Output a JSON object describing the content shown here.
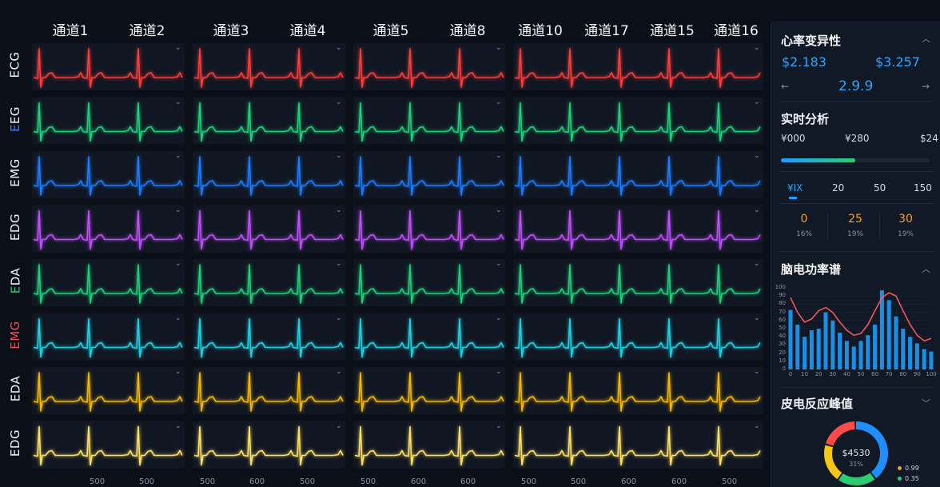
{
  "columns": [
    "通道1",
    "通道2",
    "通道3",
    "通道4",
    "通道5",
    "通道8",
    "通道10",
    "通道17",
    "通道15",
    "通道16"
  ],
  "rows": [
    {
      "label": "ECG",
      "label_color": "#f2f4f8",
      "wave_color": "#ff3b3b"
    },
    {
      "label": "EEG",
      "label_color": "#f2f4f8",
      "label_first_color": "#3d7bff",
      "wave_color": "#1fd17a"
    },
    {
      "label": "EMG",
      "label_color": "#f2f4f8",
      "wave_color": "#1e7bff"
    },
    {
      "label": "EDG",
      "label_color": "#f2f4f8",
      "wave_color": "#c24dff"
    },
    {
      "label": "EDA",
      "label_color": "#f2f4f8",
      "label_first_color": "#1fd17a",
      "wave_color": "#1fd17a"
    },
    {
      "label": "EMG",
      "label_color": "#ff4a4a",
      "wave_color": "#1fd3e6"
    },
    {
      "label": "EDA",
      "label_color": "#f2f4f8",
      "wave_color": "#f5b800"
    },
    {
      "label": "EDG",
      "label_color": "#f2f4f8",
      "wave_color": "#ffe066"
    }
  ],
  "x_axis_ticks": [
    "500",
    "500",
    "500",
    "600",
    "500",
    "500",
    "600",
    "600",
    "500",
    "500",
    "600",
    "600",
    "500"
  ],
  "panel": {
    "hrv": {
      "title": "心率变异性",
      "value_left": "$2.183",
      "value_right": "$3.257",
      "center_value": "2.9.9",
      "prev_icon": "←",
      "next_icon": "→"
    },
    "realtime": {
      "title": "实时分析",
      "labels": [
        "¥000",
        "¥280",
        "$24"
      ],
      "progress": 0.5,
      "tabs": [
        "¥IX",
        "20",
        "50",
        "150"
      ],
      "active_tab": 0,
      "stats": [
        {
          "value": "0",
          "pct": "16%"
        },
        {
          "value": "25",
          "pct": "19%"
        },
        {
          "value": "30",
          "pct": "19%"
        }
      ]
    },
    "spectrum": {
      "title": "脑电功率谱",
      "chart_data": {
        "type": "bar",
        "ylim": [
          0,
          100
        ],
        "yticks": [
          "0",
          "10",
          "20",
          "30",
          "40",
          "50",
          "60",
          "70",
          "80",
          "90",
          "100"
        ],
        "xticks": [
          "0",
          "10",
          "20",
          "30",
          "40",
          "50",
          "60",
          "70",
          "80",
          "90",
          "100"
        ],
        "x": [
          0,
          5,
          10,
          15,
          20,
          25,
          30,
          35,
          40,
          45,
          50,
          55,
          60,
          65,
          70,
          75,
          80,
          85,
          90,
          95,
          100
        ],
        "values": [
          73,
          55,
          40,
          48,
          50,
          70,
          60,
          45,
          35,
          28,
          35,
          42,
          55,
          97,
          85,
          65,
          50,
          40,
          32,
          25,
          22
        ],
        "line": [
          88,
          70,
          58,
          62,
          72,
          76,
          70,
          58,
          48,
          42,
          44,
          55,
          72,
          88,
          94,
          90,
          72,
          55,
          42,
          35,
          38
        ],
        "bar_color": "#1a8fe6",
        "line_color": "#ff5a5a"
      }
    },
    "gsr": {
      "title": "皮电反应峰值",
      "center_value": "$4530",
      "center_pct": "31%",
      "donut_segments": [
        {
          "color": "#1e8fff",
          "value": 40
        },
        {
          "color": "#2ecc71",
          "value": 20
        },
        {
          "color": "#f5c518",
          "value": 20
        },
        {
          "color": "#ff4a4a",
          "value": 20
        }
      ],
      "legend": [
        {
          "color": "#f3a12b",
          "label": "0.99"
        },
        {
          "color": "#2ecc71",
          "label": "0.35"
        }
      ]
    }
  }
}
